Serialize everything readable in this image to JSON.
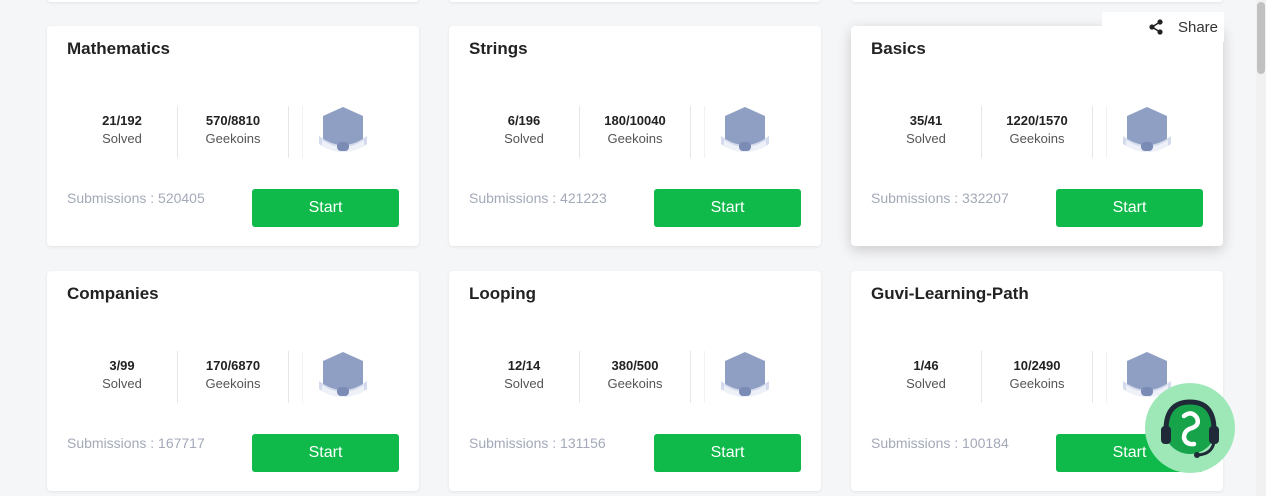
{
  "share": {
    "label": "Share",
    "icon": "share-icon"
  },
  "labels": {
    "solved": "Solved",
    "geekoins": "Geekoins",
    "start": "Start"
  },
  "colors": {
    "accent": "#0fba4a",
    "badge": "#8f9fc4",
    "muted": "#a3a9b8"
  },
  "cards": [
    {
      "title": "Mathematics",
      "solved": "21/192",
      "geekoins": "570/8810",
      "submissions": "Submissions : 520405"
    },
    {
      "title": "Strings",
      "solved": "6/196",
      "geekoins": "180/10040",
      "submissions": "Submissions : 421223"
    },
    {
      "title": "Basics",
      "solved": "35/41",
      "geekoins": "1220/1570",
      "submissions": "Submissions : 332207"
    },
    {
      "title": "Companies",
      "solved": "3/99",
      "geekoins": "170/6870",
      "submissions": "Submissions : 167717"
    },
    {
      "title": "Looping",
      "solved": "12/14",
      "geekoins": "380/500",
      "submissions": "Submissions : 131156"
    },
    {
      "title": "Guvi-Learning-Path",
      "solved": "1/46",
      "geekoins": "10/2490",
      "submissions": "Submissions : 100184"
    }
  ]
}
